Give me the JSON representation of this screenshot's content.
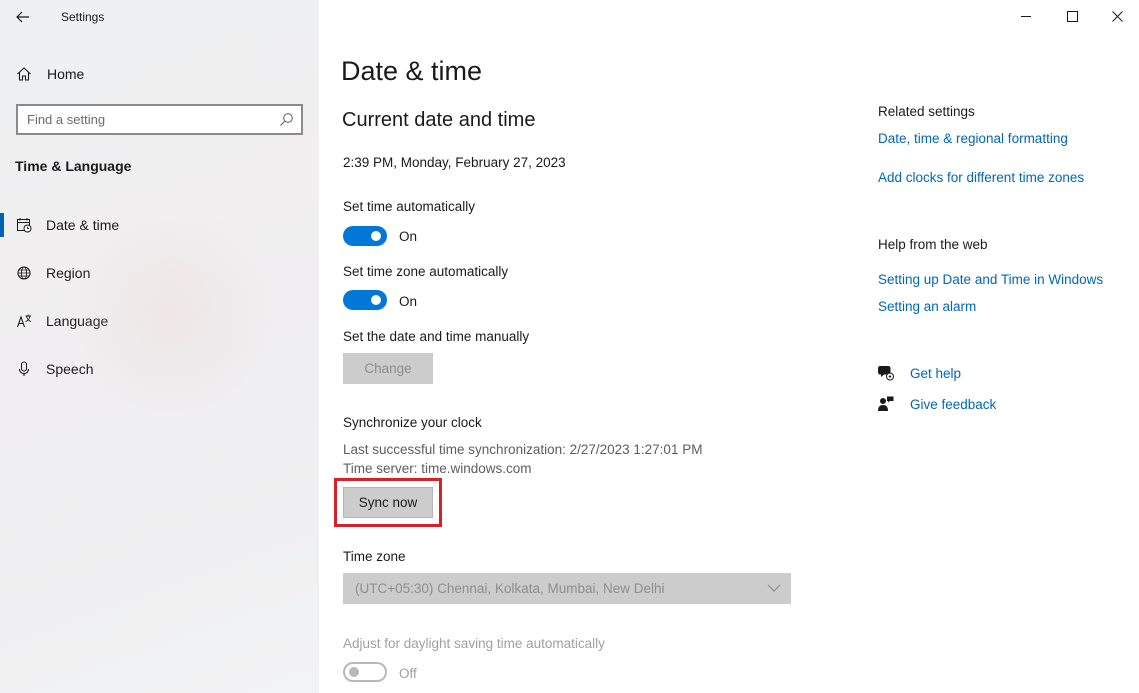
{
  "window": {
    "app_title": "Settings",
    "controls": [
      "minimize",
      "maximize",
      "close"
    ]
  },
  "sidebar": {
    "home_label": "Home",
    "search_placeholder": "Find a setting",
    "section_title": "Time & Language",
    "items": [
      {
        "label": "Date & time",
        "icon": "calendar-clock-icon",
        "selected": true
      },
      {
        "label": "Region",
        "icon": "globe-icon",
        "selected": false
      },
      {
        "label": "Language",
        "icon": "language-icon",
        "selected": false
      },
      {
        "label": "Speech",
        "icon": "microphone-icon",
        "selected": false
      }
    ]
  },
  "main": {
    "title": "Date & time",
    "subtitle": "Current date and time",
    "current_datetime": "2:39 PM, Monday, February 27, 2023",
    "set_time_auto": {
      "label": "Set time automatically",
      "state": "On",
      "on": true
    },
    "set_timezone_auto": {
      "label": "Set time zone automatically",
      "state": "On",
      "on": true
    },
    "manual": {
      "label": "Set the date and time manually",
      "button": "Change",
      "enabled": false
    },
    "sync": {
      "heading": "Synchronize your clock",
      "last_sync": "Last successful time synchronization: 2/27/2023 1:27:01 PM",
      "server": "Time server: time.windows.com",
      "button": "Sync now",
      "highlight_color": "#d9202a"
    },
    "time_zone": {
      "label": "Time zone",
      "value": "(UTC+05:30) Chennai, Kolkata, Mumbai, New Delhi",
      "enabled": false
    },
    "dst": {
      "label": "Adjust for daylight saving time automatically",
      "state": "Off",
      "on": false,
      "enabled": false
    }
  },
  "related": {
    "heading": "Related settings",
    "links": [
      "Date, time & regional formatting",
      "Add clocks for different time zones"
    ]
  },
  "help_web": {
    "heading": "Help from the web",
    "links": [
      "Setting up Date and Time in Windows",
      "Setting an alarm"
    ]
  },
  "support": {
    "get_help": "Get help",
    "give_feedback": "Give feedback"
  },
  "colors": {
    "accent": "#0078d7",
    "link": "#0067b8",
    "selection_indicator": "#0063b1"
  }
}
